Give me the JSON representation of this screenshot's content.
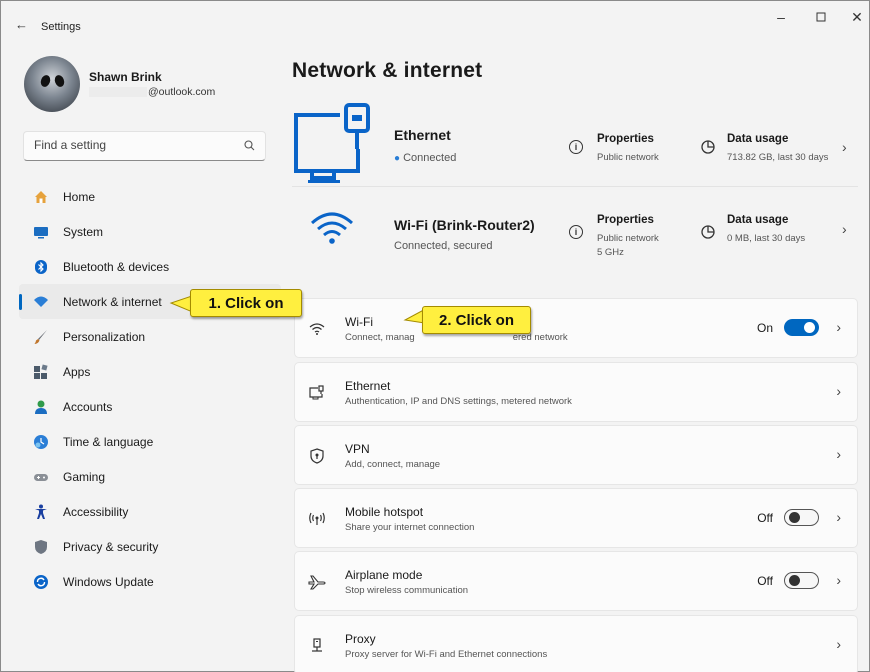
{
  "window": {
    "title": "Settings",
    "back_icon": "arrow-left",
    "controls": [
      "minimize",
      "maximize",
      "close"
    ]
  },
  "profile": {
    "name": "Shawn Brink",
    "email": "@outlook.com"
  },
  "search": {
    "placeholder": "Find a setting",
    "icon": "search-icon"
  },
  "sidebar": {
    "items": [
      {
        "label": "Home",
        "icon": "home-icon",
        "color": "#e6a23c"
      },
      {
        "label": "System",
        "icon": "system-icon",
        "color": "#1b6dc1"
      },
      {
        "label": "Bluetooth & devices",
        "icon": "bluetooth-icon",
        "color": "#0a64c8"
      },
      {
        "label": "Network & internet",
        "icon": "network-icon",
        "color": "#2a7ed6",
        "selected": true
      },
      {
        "label": "Personalization",
        "icon": "brush-icon",
        "color": "#c0762d"
      },
      {
        "label": "Apps",
        "icon": "apps-icon",
        "color": "#4b5a6a"
      },
      {
        "label": "Accounts",
        "icon": "accounts-icon",
        "color": "#2f9a4a"
      },
      {
        "label": "Time & language",
        "icon": "time-language-icon",
        "color": "#2a7ed6"
      },
      {
        "label": "Gaming",
        "icon": "gaming-icon",
        "color": "#8a8f96"
      },
      {
        "label": "Accessibility",
        "icon": "accessibility-icon",
        "color": "#1a3fa0"
      },
      {
        "label": "Privacy & security",
        "icon": "shield-icon",
        "color": "#6e7682"
      },
      {
        "label": "Windows Update",
        "icon": "windows-update-icon",
        "color": "#0a64c8"
      }
    ]
  },
  "main": {
    "title": "Network & internet",
    "ethernet_hero": {
      "name": "Ethernet",
      "status": "Connected",
      "properties_title": "Properties",
      "properties_sub": "Public network",
      "usage_title": "Data usage",
      "usage_sub": "713.82 GB, last 30 days"
    },
    "wifi_hero": {
      "name": "Wi-Fi (Brink-Router2)",
      "status": "Connected, secured",
      "properties_title": "Properties",
      "properties_sub": "Public network",
      "properties_sub2": "5 GHz",
      "usage_title": "Data usage",
      "usage_sub": "0 MB, last 30 days"
    },
    "cards": [
      {
        "title": "Wi-Fi",
        "sub_left": "Connect, manag",
        "sub_right": "ered network",
        "toggle": "On",
        "icon": "wifi-icon"
      },
      {
        "title": "Ethernet",
        "sub": "Authentication, IP and DNS settings, metered network",
        "icon": "ethernet-icon"
      },
      {
        "title": "VPN",
        "sub": "Add, connect, manage",
        "icon": "vpn-shield-icon"
      },
      {
        "title": "Mobile hotspot",
        "sub": "Share your internet connection",
        "toggle": "Off",
        "icon": "hotspot-icon"
      },
      {
        "title": "Airplane mode",
        "sub": "Stop wireless communication",
        "toggle": "Off",
        "icon": "airplane-icon"
      },
      {
        "title": "Proxy",
        "sub": "Proxy server for Wi-Fi and Ethernet connections",
        "icon": "proxy-icon"
      }
    ]
  },
  "callouts": {
    "step1": "1. Click on",
    "step2": "2. Click on",
    "color": "#ffef3f"
  },
  "accent_color": "#0067c0"
}
